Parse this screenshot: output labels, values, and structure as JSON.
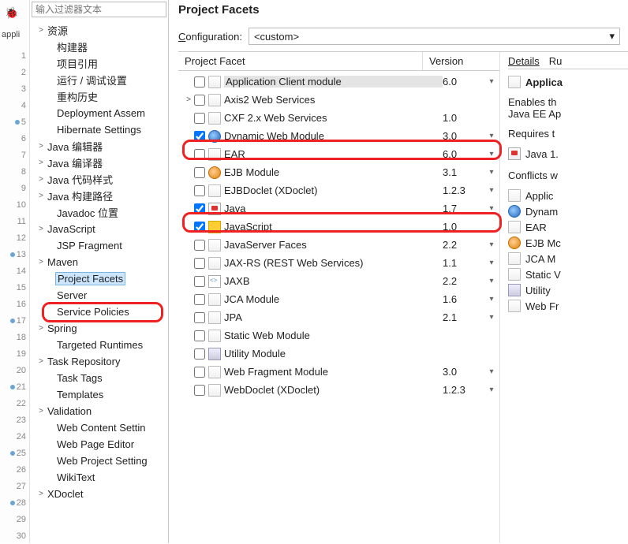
{
  "sidebar": {
    "filter_placeholder": "输入过滤器文本",
    "items": [
      {
        "label": "资源",
        "arrow": ">",
        "child": false
      },
      {
        "label": "构建器",
        "arrow": "",
        "child": true
      },
      {
        "label": "项目引用",
        "arrow": "",
        "child": true
      },
      {
        "label": "运行 / 调试设置",
        "arrow": "",
        "child": true
      },
      {
        "label": "重构历史",
        "arrow": "",
        "child": true
      },
      {
        "label": "Deployment Assem",
        "arrow": "",
        "child": true
      },
      {
        "label": "Hibernate Settings",
        "arrow": "",
        "child": true
      },
      {
        "label": "Java 编辑器",
        "arrow": ">",
        "child": false
      },
      {
        "label": "Java 编译器",
        "arrow": ">",
        "child": false
      },
      {
        "label": "Java 代码样式",
        "arrow": ">",
        "child": false
      },
      {
        "label": "Java 构建路径",
        "arrow": ">",
        "child": false
      },
      {
        "label": "Javadoc 位置",
        "arrow": "",
        "child": true
      },
      {
        "label": "JavaScript",
        "arrow": ">",
        "child": false
      },
      {
        "label": "JSP Fragment",
        "arrow": "",
        "child": true
      },
      {
        "label": "Maven",
        "arrow": ">",
        "child": false
      },
      {
        "label": "Project Facets",
        "arrow": "",
        "child": true,
        "selected": true
      },
      {
        "label": "Server",
        "arrow": "",
        "child": true
      },
      {
        "label": "Service Policies",
        "arrow": "",
        "child": true
      },
      {
        "label": "Spring",
        "arrow": ">",
        "child": false
      },
      {
        "label": "Targeted Runtimes",
        "arrow": "",
        "child": true
      },
      {
        "label": "Task Repository",
        "arrow": ">",
        "child": false
      },
      {
        "label": "Task Tags",
        "arrow": "",
        "child": true
      },
      {
        "label": "Templates",
        "arrow": "",
        "child": true
      },
      {
        "label": "Validation",
        "arrow": ">",
        "child": false
      },
      {
        "label": "Web Content Settin",
        "arrow": "",
        "child": true
      },
      {
        "label": "Web Page Editor",
        "arrow": "",
        "child": true
      },
      {
        "label": "Web Project Setting",
        "arrow": "",
        "child": true
      },
      {
        "label": "WikiText",
        "arrow": "",
        "child": true
      },
      {
        "label": "XDoclet",
        "arrow": ">",
        "child": false
      }
    ]
  },
  "gutter": {
    "label": "appli",
    "lines": [
      1,
      2,
      3,
      4,
      5,
      6,
      7,
      8,
      9,
      10,
      11,
      12,
      13,
      14,
      15,
      16,
      17,
      18,
      19,
      20,
      21,
      22,
      23,
      24,
      25,
      26,
      27,
      28,
      29,
      30
    ],
    "markers": [
      5,
      13,
      17,
      21,
      25,
      28
    ]
  },
  "main": {
    "title": "Project Facets",
    "config_label_C": "C",
    "config_label_rest": "onfiguration:",
    "config_value": "<custom>",
    "headers": {
      "col1": "Project Facet",
      "col2": "Version"
    },
    "facets": [
      {
        "name": "Application Client module",
        "ver": "6.0",
        "dd": true,
        "chk": false,
        "icon": "i-page",
        "sel": true
      },
      {
        "name": "Axis2 Web Services",
        "ver": "",
        "dd": false,
        "chk": false,
        "icon": "i-page",
        "exp": ">"
      },
      {
        "name": "CXF 2.x Web Services",
        "ver": "1.0",
        "dd": false,
        "chk": false,
        "icon": "i-page"
      },
      {
        "name": "Dynamic Web Module",
        "ver": "3.0",
        "dd": true,
        "chk": true,
        "icon": "i-globe",
        "hl": true
      },
      {
        "name": "EAR",
        "ver": "6.0",
        "dd": true,
        "chk": false,
        "icon": "i-page"
      },
      {
        "name": "EJB Module",
        "ver": "3.1",
        "dd": true,
        "chk": false,
        "icon": "i-bean"
      },
      {
        "name": "EJBDoclet (XDoclet)",
        "ver": "1.2.3",
        "dd": true,
        "chk": false,
        "icon": "i-page"
      },
      {
        "name": "Java",
        "ver": "1.7",
        "dd": true,
        "chk": true,
        "icon": "i-cup",
        "hl": true
      },
      {
        "name": "JavaScript",
        "ver": "1.0",
        "dd": false,
        "chk": true,
        "icon": "i-js"
      },
      {
        "name": "JavaServer Faces",
        "ver": "2.2",
        "dd": true,
        "chk": false,
        "icon": "i-page"
      },
      {
        "name": "JAX-RS (REST Web Services)",
        "ver": "1.1",
        "dd": true,
        "chk": false,
        "icon": "i-page"
      },
      {
        "name": "JAXB",
        "ver": "2.2",
        "dd": true,
        "chk": false,
        "icon": "i-xml"
      },
      {
        "name": "JCA Module",
        "ver": "1.6",
        "dd": true,
        "chk": false,
        "icon": "i-page"
      },
      {
        "name": "JPA",
        "ver": "2.1",
        "dd": true,
        "chk": false,
        "icon": "i-page"
      },
      {
        "name": "Static Web Module",
        "ver": "",
        "dd": false,
        "chk": false,
        "icon": "i-page"
      },
      {
        "name": "Utility Module",
        "ver": "",
        "dd": false,
        "chk": false,
        "icon": "i-jar"
      },
      {
        "name": "Web Fragment Module",
        "ver": "3.0",
        "dd": true,
        "chk": false,
        "icon": "i-page"
      },
      {
        "name": "WebDoclet (XDoclet)",
        "ver": "1.2.3",
        "dd": true,
        "chk": false,
        "icon": "i-page"
      }
    ]
  },
  "details": {
    "tabs": [
      "Details",
      "Ru"
    ],
    "title": "Applica",
    "desc1": "Enables th",
    "desc2": "Java EE Ap",
    "req_head": "Requires t",
    "req_item": "Java 1.",
    "conf_head": "Conflicts w",
    "conflicts": [
      {
        "label": "Applic",
        "icon": "i-page"
      },
      {
        "label": "Dynam",
        "icon": "i-globe"
      },
      {
        "label": "EAR",
        "icon": "i-page"
      },
      {
        "label": "EJB Mc",
        "icon": "i-bean"
      },
      {
        "label": "JCA M",
        "icon": "i-page"
      },
      {
        "label": "Static V",
        "icon": "i-page"
      },
      {
        "label": "Utility",
        "icon": "i-jar"
      },
      {
        "label": "Web Fr",
        "icon": "i-page"
      }
    ]
  }
}
